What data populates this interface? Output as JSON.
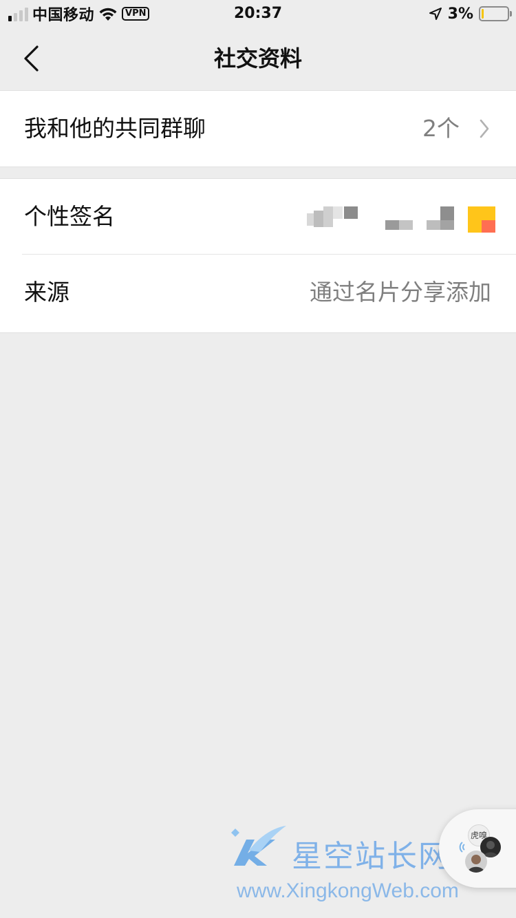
{
  "status_bar": {
    "carrier": "中国移动",
    "vpn": "VPN",
    "time": "20:37",
    "battery_percent": "3%",
    "battery_level": 0.03,
    "signal_bars_active": 1,
    "signal_bars_total": 4
  },
  "nav": {
    "title": "社交资料",
    "back_icon": "chevron-left-icon"
  },
  "cells": {
    "common_groups": {
      "label": "我和他的共同群聊",
      "value": "2个",
      "arrow_icon": "chevron-right-icon"
    },
    "signature": {
      "label": "个性签名"
    },
    "source": {
      "label": "来源",
      "value": "通过名片分享添加"
    }
  },
  "watermark": {
    "title": "星空站长网",
    "url": "www.XingkongWeb.com"
  },
  "float_bubble": {
    "avatar_text": "虎嗅"
  },
  "colors": {
    "background": "#EDEDED",
    "cell_background": "#FFFFFF",
    "secondary_text": "#7F7F7F",
    "battery_fill": "#F5C400",
    "watermark": "#7FB1E8"
  }
}
